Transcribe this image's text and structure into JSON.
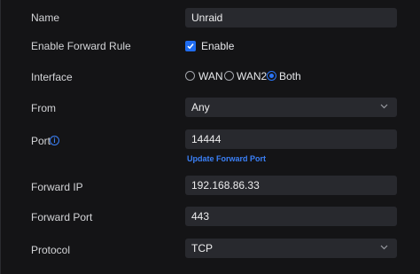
{
  "form": {
    "name": {
      "label": "Name",
      "value": "Unraid"
    },
    "enable_forward_rule": {
      "label": "Enable Forward Rule",
      "checkbox_label": "Enable",
      "checked": true
    },
    "interface": {
      "label": "Interface",
      "options": [
        "WAN",
        "WAN2",
        "Both"
      ],
      "selected": "Both"
    },
    "from": {
      "label": "From",
      "value": "Any"
    },
    "port": {
      "label": "Port",
      "value": "14444",
      "info_icon": "info-icon",
      "link_label": "Update Forward Port"
    },
    "forward_ip": {
      "label": "Forward IP",
      "value": "192.168.86.33"
    },
    "forward_port": {
      "label": "Forward Port",
      "value": "443"
    },
    "protocol": {
      "label": "Protocol",
      "value": "TCP"
    }
  },
  "colors": {
    "background": "#141416",
    "field": "#28292e",
    "accent": "#1f6cf0",
    "link": "#3b80f7"
  }
}
